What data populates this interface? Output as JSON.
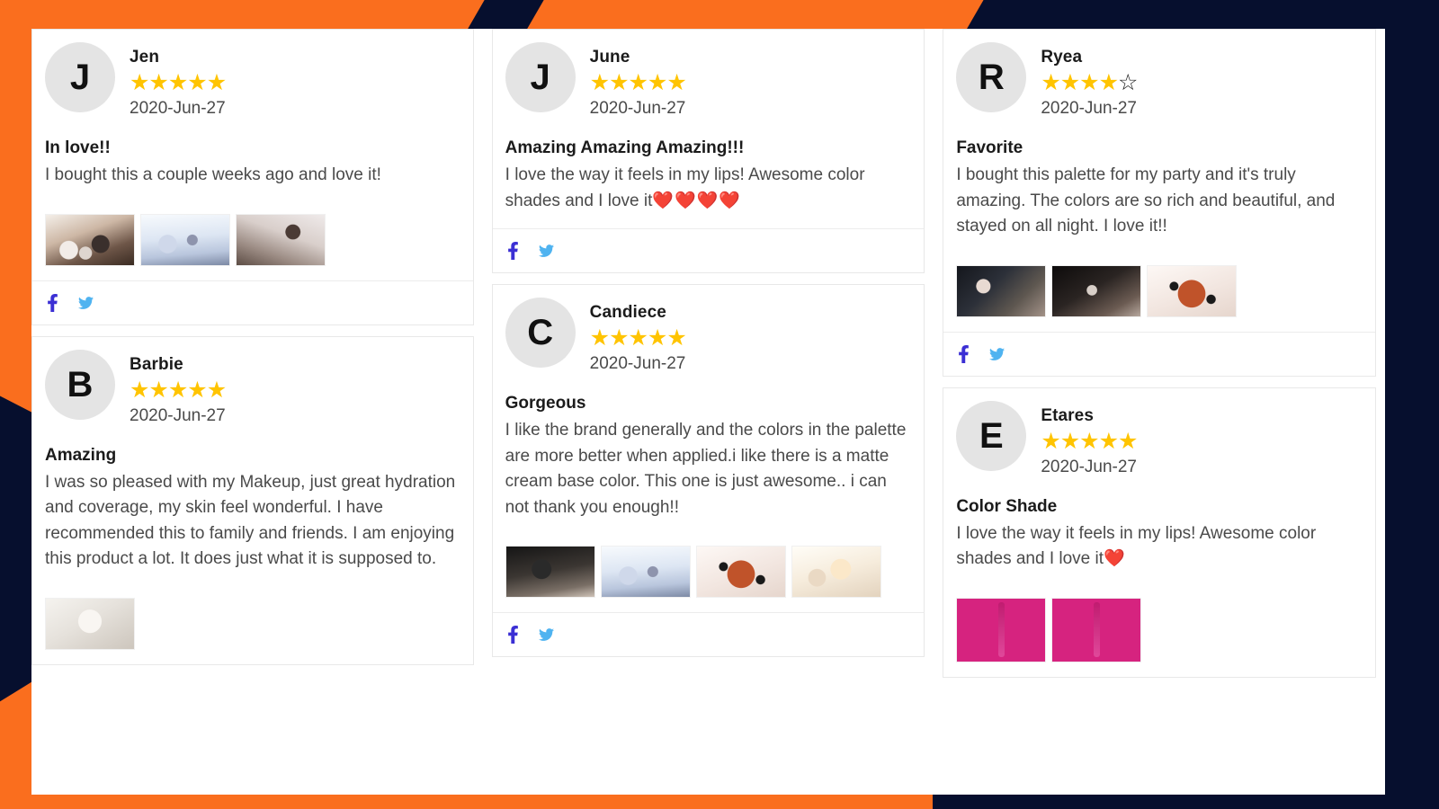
{
  "theme": {
    "orange": "#FA6E1E",
    "navy": "#060F2E",
    "star_on": "#FFC400",
    "star_off": "#1b1b1b",
    "heart": "#e8112d",
    "facebook_blue": "#3b2fd4",
    "twitter_blue": "#4fb3f0",
    "avatar_bg": "#e4e4e4"
  },
  "icons": {
    "facebook": "facebook-icon",
    "twitter": "twitter-icon",
    "star_filled": "star-filled-icon",
    "star_outline": "star-outline-icon",
    "heart": "heart-icon"
  },
  "columns": [
    {
      "reviews": [
        {
          "avatar_letter": "J",
          "name": "Jen",
          "rating": 5,
          "max_rating": 5,
          "date": "2020-Jun-27",
          "title": "In love!!",
          "text": "I bought this a couple weeks ago and love it!",
          "hearts": 0,
          "thumbnails": [
            "ph-a",
            "ph-b",
            "ph-c"
          ],
          "thumb_style": "wide",
          "has_footer": true
        },
        {
          "avatar_letter": "B",
          "name": "Barbie",
          "rating": 5,
          "max_rating": 5,
          "date": "2020-Jun-27",
          "title": "Amazing",
          "text": "I was so pleased with my Makeup, just great hydration and coverage, my skin feel wonderful. I have recommended this to family and friends. I am enjoying this product a lot. It does just what it is supposed to.",
          "hearts": 0,
          "thumbnails": [
            "ph-i"
          ],
          "thumb_style": "wide",
          "has_footer": false
        }
      ]
    },
    {
      "reviews": [
        {
          "avatar_letter": "J",
          "name": "June",
          "rating": 5,
          "max_rating": 5,
          "date": "2020-Jun-27",
          "title": "Amazing Amazing Amazing!!!",
          "text": "I love the way it feels in my lips! Awesome color shades and I love it",
          "hearts": 4,
          "thumbnails": [],
          "thumb_style": "wide",
          "has_footer": true
        },
        {
          "avatar_letter": "C",
          "name": "Candiece",
          "rating": 5,
          "max_rating": 5,
          "date": "2020-Jun-27",
          "title": "Gorgeous",
          "text": "I like the brand generally and the colors in the palette are more better when applied.i like there is a matte cream base color. This one is just awesome.. i can not thank you enough!!",
          "hearts": 0,
          "thumbnails": [
            "ph-g",
            "ph-b",
            "ph-f",
            "ph-h"
          ],
          "thumb_style": "wide",
          "has_footer": true
        }
      ]
    },
    {
      "reviews": [
        {
          "avatar_letter": "R",
          "name": "Ryea",
          "rating": 4,
          "max_rating": 5,
          "date": "2020-Jun-27",
          "title": "Favorite",
          "text": "I bought this palette for my party and it's truly amazing. The colors are so rich and beautiful, and stayed on all night. I love it!!",
          "hearts": 0,
          "thumbnails": [
            "ph-e",
            "ph-d",
            "ph-f"
          ],
          "thumb_style": "wide",
          "has_footer": true
        },
        {
          "avatar_letter": "E",
          "name": "Etares",
          "rating": 5,
          "max_rating": 5,
          "date": "2020-Jun-27",
          "title": "Color Shade",
          "text": "I love the way it feels in my lips! Awesome color shades and I love it",
          "hearts": 1,
          "thumbnails": [
            "ph-pink",
            "ph-pink"
          ],
          "thumb_style": "square",
          "has_footer": false
        }
      ]
    }
  ]
}
